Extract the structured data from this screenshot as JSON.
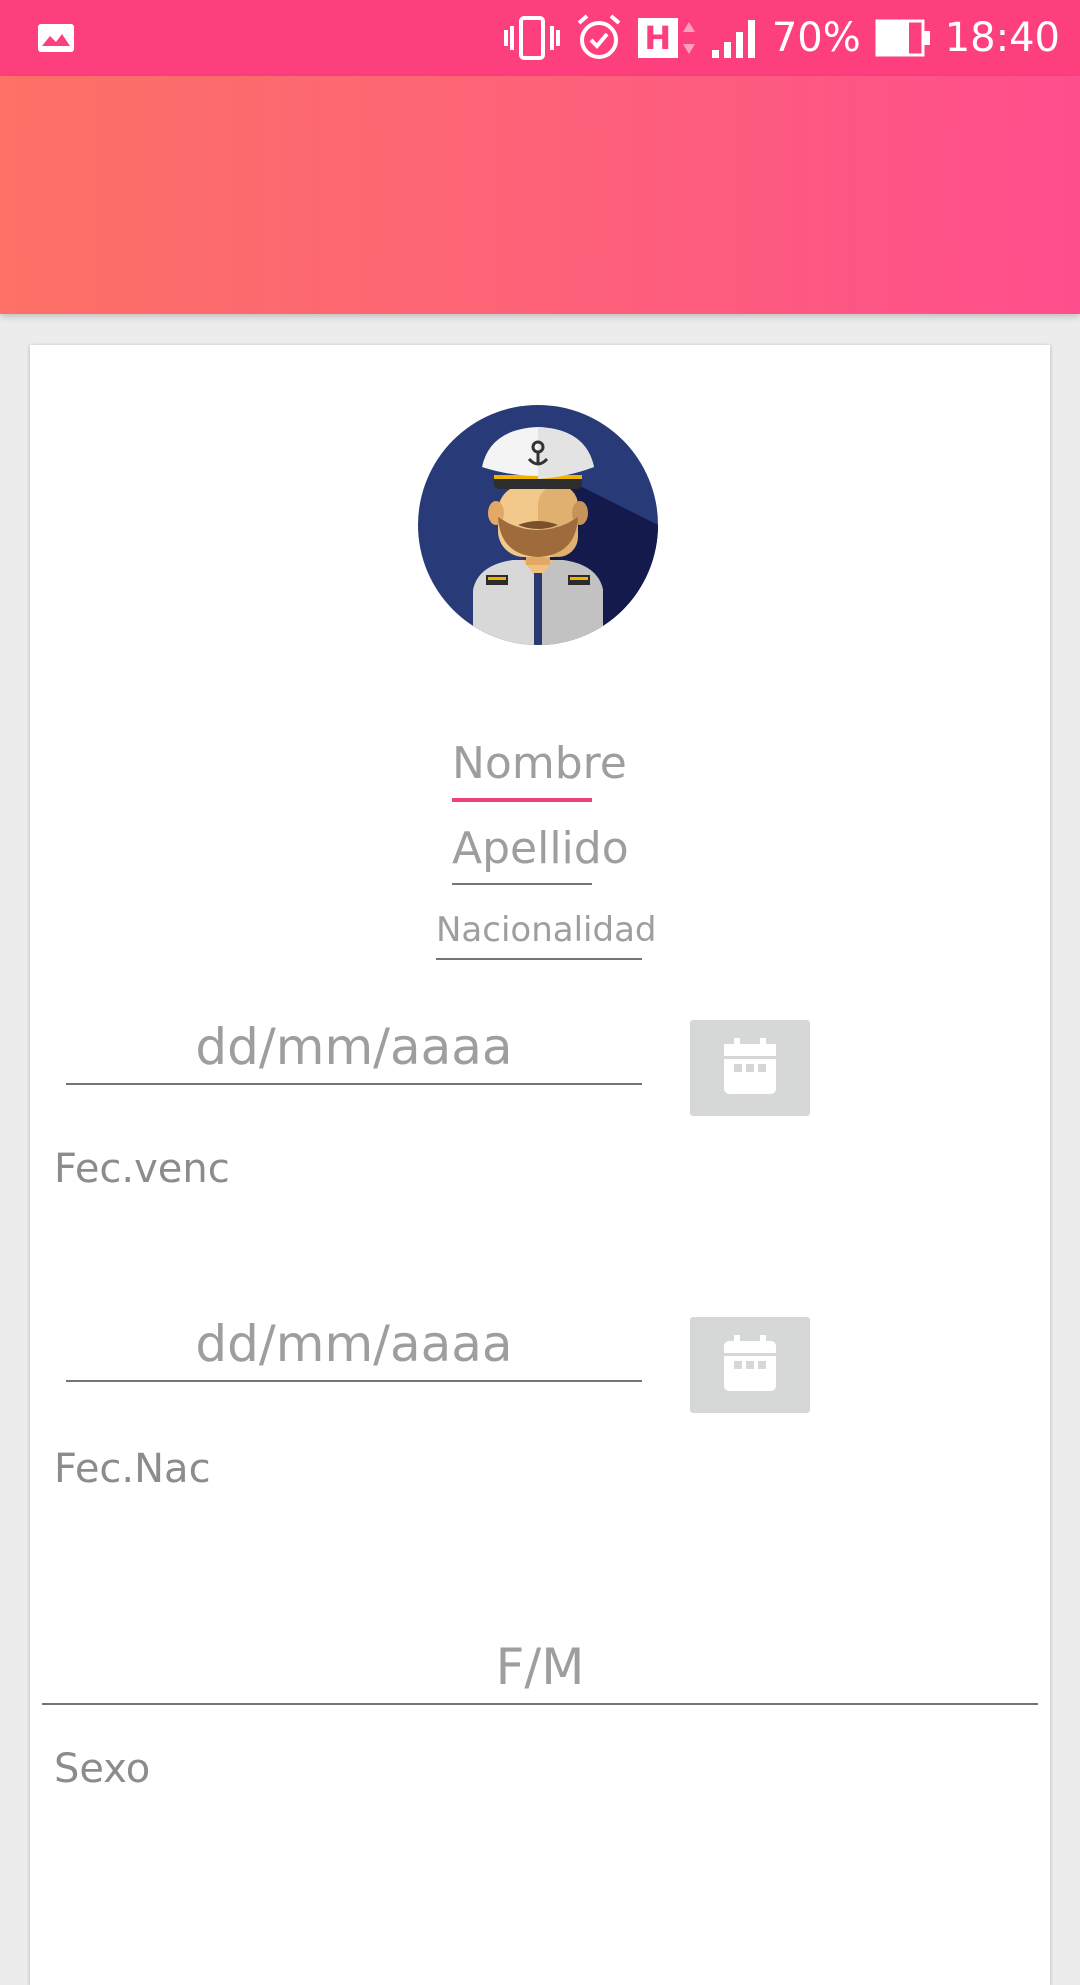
{
  "status_bar": {
    "battery_text": "70%",
    "time": "18:40",
    "network_label": "H",
    "icons": [
      "gallery-notification-icon",
      "vibrate-icon",
      "alarm-icon",
      "network-h-icon",
      "signal-icon",
      "battery-icon"
    ],
    "color": "#fe3f7e"
  },
  "header": {
    "gradient_colors": [
      "#fd7166",
      "#ff4e8d"
    ]
  },
  "form": {
    "avatar_icon": "captain-avatar",
    "nombre_placeholder": "Nombre",
    "apellido_placeholder": "Apellido",
    "nacionalidad_placeholder": "Nacionalidad",
    "fec_venc": {
      "placeholder": "dd/mm/aaaa",
      "label": "Fec.venc",
      "button_icon": "calendar-icon"
    },
    "fec_nac": {
      "placeholder": "dd/mm/aaaa",
      "label": "Fec.Nac",
      "button_icon": "calendar-icon"
    },
    "sexo": {
      "placeholder": "F/M",
      "label": "Sexo"
    },
    "accent_color": "#f0427a"
  }
}
